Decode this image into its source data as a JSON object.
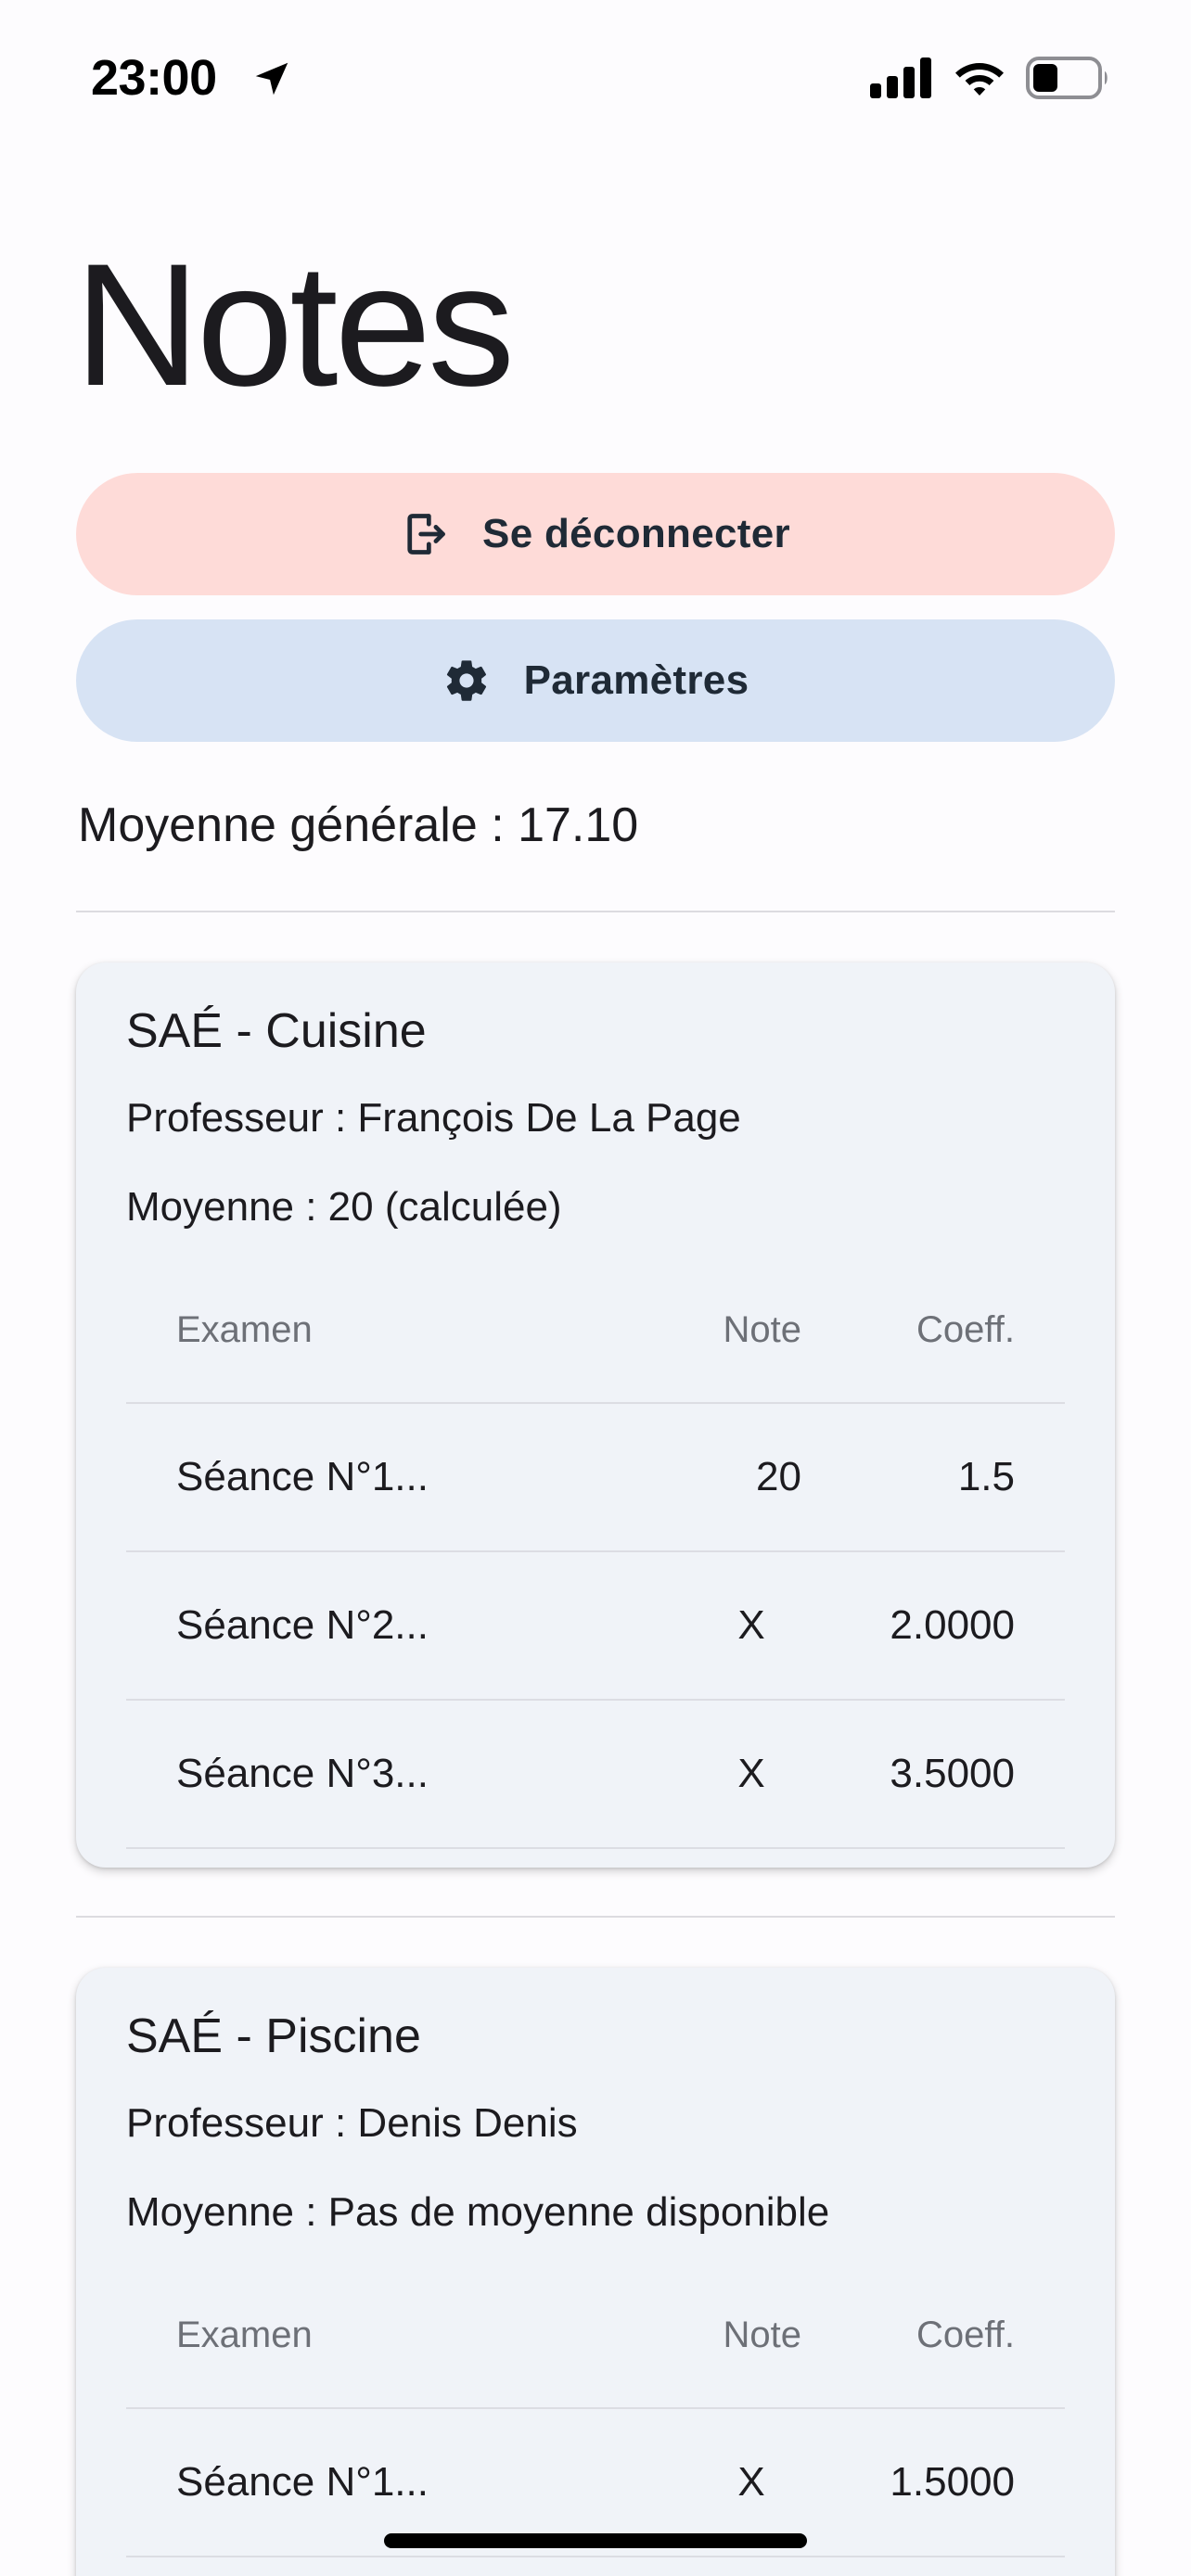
{
  "status_bar": {
    "time": "23:00",
    "icons": [
      "location-arrow-icon",
      "cellular-signal-icon",
      "wifi-icon",
      "battery-icon"
    ]
  },
  "page": {
    "title": "Notes"
  },
  "actions": {
    "logout_label": "Se déconnecter",
    "logout_icon": "logout-icon",
    "logout_color": "#fedbd8",
    "settings_label": "Paramètres",
    "settings_icon": "gear-icon",
    "settings_color": "#d7e3f4"
  },
  "overall_average": "Moyenne générale : 17.10",
  "table_headers": {
    "exam": "Examen",
    "note": "Note",
    "coeff": "Coeff."
  },
  "subjects": [
    {
      "title": "SAÉ - Cuisine",
      "teacher": "Professeur : François De La Page",
      "average": "Moyenne : 20 (calculée)",
      "rows": [
        {
          "exam": "Séance N°1...",
          "note": "20",
          "coeff": "1.5"
        },
        {
          "exam": "Séance N°2...",
          "note": "X",
          "coeff": "2.0000"
        },
        {
          "exam": "Séance N°3...",
          "note": "X",
          "coeff": "3.5000"
        }
      ]
    },
    {
      "title": "SAÉ - Piscine",
      "teacher": "Professeur : Denis Denis",
      "average": "Moyenne : Pas de moyenne disponible",
      "rows": [
        {
          "exam": "Séance N°1...",
          "note": "X",
          "coeff": "1.5000"
        }
      ]
    }
  ]
}
